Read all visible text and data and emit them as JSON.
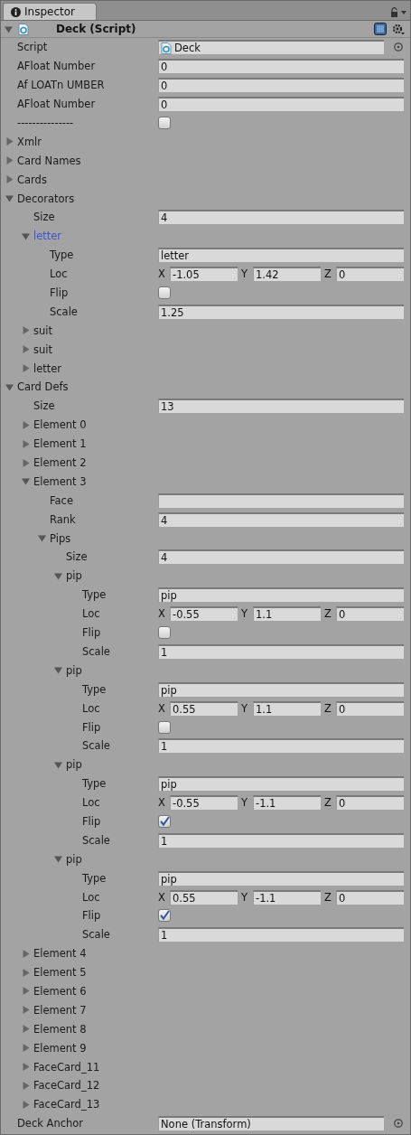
{
  "tab": {
    "label": "Inspector",
    "selected": true
  },
  "component": {
    "title": "Deck (Script)",
    "expanded": true
  },
  "properties": [
    {
      "kind": "script",
      "label": "Script",
      "value": "Deck"
    },
    {
      "kind": "field",
      "label": "AFloat Number",
      "value": "0"
    },
    {
      "kind": "field",
      "label": "Af LOATn UMBER",
      "value": "0"
    },
    {
      "kind": "field",
      "label": "AFloat Number",
      "value": "0"
    },
    {
      "kind": "checkbox",
      "label": "---------------",
      "checked": false
    },
    {
      "kind": "foldout",
      "label": "Xmlr",
      "expanded": false,
      "selected": false
    },
    {
      "kind": "foldout",
      "label": "Card Names",
      "expanded": false,
      "selected": false
    },
    {
      "kind": "foldout",
      "label": "Cards",
      "expanded": false,
      "selected": false
    },
    {
      "kind": "foldout",
      "label": "Decorators",
      "expanded": true,
      "selected": false,
      "children": [
        {
          "kind": "field",
          "label": "Size",
          "value": "4"
        },
        {
          "kind": "foldout",
          "label": "letter",
          "expanded": true,
          "selected": true,
          "children": [
            {
              "kind": "field",
              "label": "Type",
              "value": "letter"
            },
            {
              "kind": "vector",
              "label": "Loc",
              "components": [
                {
                  "axis": "X",
                  "value": "-1.05"
                },
                {
                  "axis": "Y",
                  "value": "1.42"
                },
                {
                  "axis": "Z",
                  "value": "0"
                }
              ]
            },
            {
              "kind": "checkbox",
              "label": "Flip",
              "checked": false
            },
            {
              "kind": "field",
              "label": "Scale",
              "value": "1.25"
            }
          ]
        },
        {
          "kind": "foldout",
          "label": "suit",
          "expanded": false,
          "selected": false
        },
        {
          "kind": "foldout",
          "label": "suit",
          "expanded": false,
          "selected": false
        },
        {
          "kind": "foldout",
          "label": "letter",
          "expanded": false,
          "selected": false
        }
      ]
    },
    {
      "kind": "foldout",
      "label": "Card Defs",
      "expanded": true,
      "selected": false,
      "children": [
        {
          "kind": "field",
          "label": "Size",
          "value": "13"
        },
        {
          "kind": "foldout",
          "label": "Element 0",
          "expanded": false,
          "selected": false
        },
        {
          "kind": "foldout",
          "label": "Element 1",
          "expanded": false,
          "selected": false
        },
        {
          "kind": "foldout",
          "label": "Element 2",
          "expanded": false,
          "selected": false
        },
        {
          "kind": "foldout",
          "label": "Element 3",
          "expanded": true,
          "selected": false,
          "children": [
            {
              "kind": "field",
              "label": "Face"
            },
            {
              "kind": "field",
              "label": "Rank",
              "value": "4"
            },
            {
              "kind": "foldout",
              "label": "Pips",
              "expanded": true,
              "selected": false,
              "children": [
                {
                  "kind": "field",
                  "label": "Size",
                  "value": "4"
                },
                {
                  "kind": "foldout",
                  "label": "pip",
                  "expanded": true,
                  "selected": false,
                  "children": [
                    {
                      "kind": "field",
                      "label": "Type",
                      "value": "pip"
                    },
                    {
                      "kind": "vector",
                      "label": "Loc",
                      "components": [
                        {
                          "axis": "X",
                          "value": "-0.55"
                        },
                        {
                          "axis": "Y",
                          "value": "1.1"
                        },
                        {
                          "axis": "Z",
                          "value": "0"
                        }
                      ]
                    },
                    {
                      "kind": "checkbox",
                      "label": "Flip",
                      "checked": false
                    },
                    {
                      "kind": "field",
                      "label": "Scale",
                      "value": "1"
                    }
                  ]
                },
                {
                  "kind": "foldout",
                  "label": "pip",
                  "expanded": true,
                  "selected": false,
                  "children": [
                    {
                      "kind": "field",
                      "label": "Type",
                      "value": "pip"
                    },
                    {
                      "kind": "vector",
                      "label": "Loc",
                      "components": [
                        {
                          "axis": "X",
                          "value": "0.55"
                        },
                        {
                          "axis": "Y",
                          "value": "1.1"
                        },
                        {
                          "axis": "Z",
                          "value": "0"
                        }
                      ]
                    },
                    {
                      "kind": "checkbox",
                      "label": "Flip",
                      "checked": false
                    },
                    {
                      "kind": "field",
                      "label": "Scale",
                      "value": "1"
                    }
                  ]
                },
                {
                  "kind": "foldout",
                  "label": "pip",
                  "expanded": true,
                  "selected": false,
                  "children": [
                    {
                      "kind": "field",
                      "label": "Type",
                      "value": "pip"
                    },
                    {
                      "kind": "vector",
                      "label": "Loc",
                      "components": [
                        {
                          "axis": "X",
                          "value": "-0.55"
                        },
                        {
                          "axis": "Y",
                          "value": "-1.1"
                        },
                        {
                          "axis": "Z",
                          "value": "0"
                        }
                      ]
                    },
                    {
                      "kind": "checkbox",
                      "label": "Flip",
                      "checked": true
                    },
                    {
                      "kind": "field",
                      "label": "Scale",
                      "value": "1"
                    }
                  ]
                },
                {
                  "kind": "foldout",
                  "label": "pip",
                  "expanded": true,
                  "selected": false,
                  "children": [
                    {
                      "kind": "field",
                      "label": "Type",
                      "value": "pip"
                    },
                    {
                      "kind": "vector",
                      "label": "Loc",
                      "components": [
                        {
                          "axis": "X",
                          "value": "0.55"
                        },
                        {
                          "axis": "Y",
                          "value": "-1.1"
                        },
                        {
                          "axis": "Z",
                          "value": "0"
                        }
                      ]
                    },
                    {
                      "kind": "checkbox",
                      "label": "Flip",
                      "checked": true
                    },
                    {
                      "kind": "field",
                      "label": "Scale",
                      "value": "1"
                    }
                  ]
                }
              ]
            }
          ]
        },
        {
          "kind": "foldout",
          "label": "Element 4",
          "expanded": false,
          "selected": false
        },
        {
          "kind": "foldout",
          "label": "Element 5",
          "expanded": false,
          "selected": false
        },
        {
          "kind": "foldout",
          "label": "Element 6",
          "expanded": false,
          "selected": false
        },
        {
          "kind": "foldout",
          "label": "Element 7",
          "expanded": false,
          "selected": false
        },
        {
          "kind": "foldout",
          "label": "Element 8",
          "expanded": false,
          "selected": false
        },
        {
          "kind": "foldout",
          "label": "Element 9",
          "expanded": false,
          "selected": false
        },
        {
          "kind": "foldout",
          "label": "FaceCard_11",
          "expanded": false,
          "selected": false
        },
        {
          "kind": "foldout",
          "label": "FaceCard_12",
          "expanded": false,
          "selected": false
        },
        {
          "kind": "foldout",
          "label": "FaceCard_13",
          "expanded": false,
          "selected": false
        }
      ]
    },
    {
      "kind": "object",
      "label": "Deck Anchor",
      "value": "None (Transform)"
    }
  ]
}
